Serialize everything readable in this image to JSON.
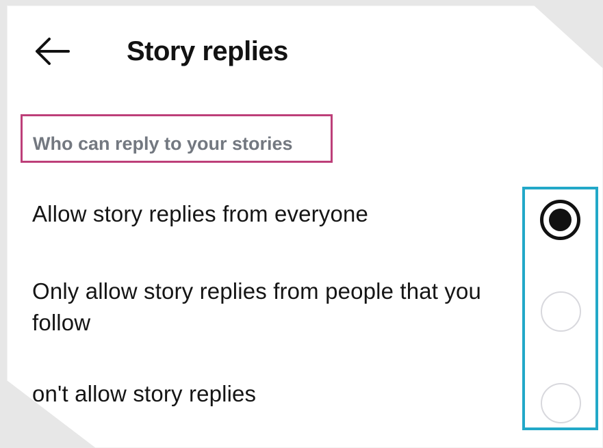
{
  "header": {
    "title": "Story replies",
    "back_icon": "arrow-left-icon"
  },
  "section": {
    "title": "Who can reply to your stories"
  },
  "options": [
    {
      "label": "Allow story replies from everyone",
      "selected": true
    },
    {
      "label": "Only allow story replies from people that you follow",
      "selected": false
    },
    {
      "label": "on't allow story replies",
      "selected": false
    }
  ],
  "colors": {
    "section_highlight": "#bd3f79",
    "radio_highlight": "#22a8c8",
    "text_primary": "#151515",
    "text_secondary": "#737880"
  }
}
